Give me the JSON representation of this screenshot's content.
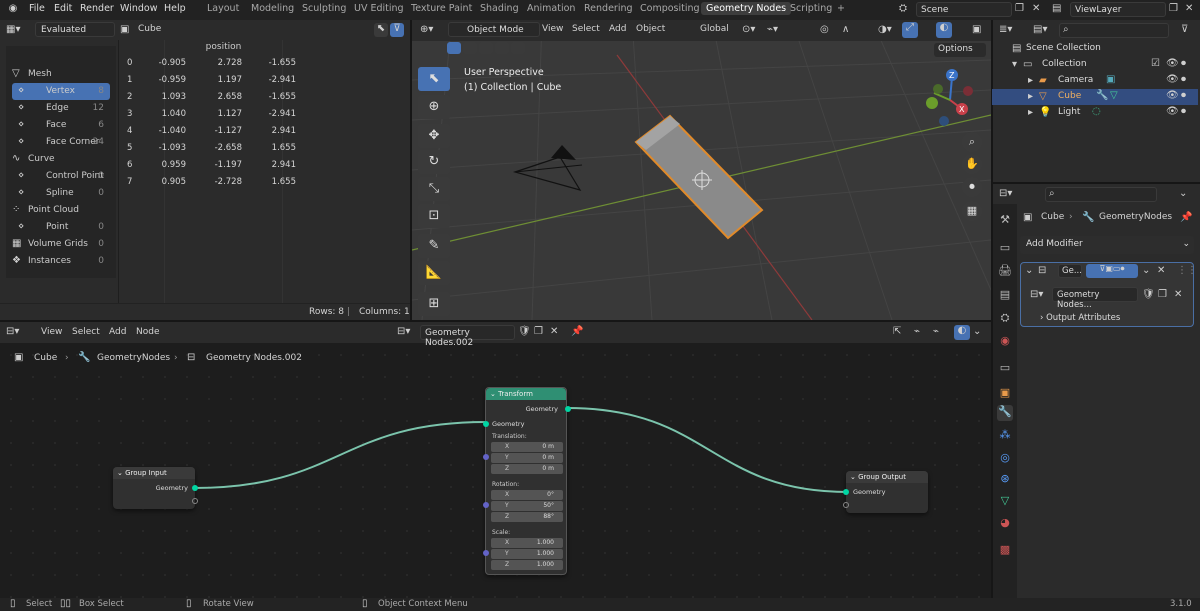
{
  "topbar": {
    "menus": [
      "File",
      "Edit",
      "Render",
      "Window",
      "Help"
    ],
    "workspaces": [
      "Layout",
      "Modeling",
      "Sculpting",
      "UV Editing",
      "Texture Paint",
      "Shading",
      "Animation",
      "Rendering",
      "Compositing",
      "Geometry Nodes",
      "Scripting",
      "+"
    ],
    "scene": "Scene",
    "viewlayer": "ViewLayer"
  },
  "spreadsheet": {
    "mode": "Evaluated",
    "object": "Cube",
    "col_header": "position",
    "tree": [
      {
        "label": "Mesh",
        "count": ""
      },
      {
        "label": "Vertex",
        "count": "8"
      },
      {
        "label": "Edge",
        "count": "12"
      },
      {
        "label": "Face",
        "count": "6"
      },
      {
        "label": "Face Corner",
        "count": "24"
      },
      {
        "label": "Curve",
        "count": ""
      },
      {
        "label": "Control Point",
        "count": "0"
      },
      {
        "label": "Spline",
        "count": "0"
      },
      {
        "label": "Point Cloud",
        "count": ""
      },
      {
        "label": "Point",
        "count": "0"
      },
      {
        "label": "Volume Grids",
        "count": "0"
      },
      {
        "label": "Instances",
        "count": "0"
      }
    ],
    "rows": [
      [
        "0",
        "-0.905",
        "2.728",
        "-1.655"
      ],
      [
        "1",
        "-0.959",
        "1.197",
        "-2.941"
      ],
      [
        "2",
        "1.093",
        "2.658",
        "-1.655"
      ],
      [
        "3",
        "1.040",
        "1.127",
        "-2.941"
      ],
      [
        "4",
        "-1.040",
        "-1.127",
        "2.941"
      ],
      [
        "5",
        "-1.093",
        "-2.658",
        "1.655"
      ],
      [
        "6",
        "0.959",
        "-1.197",
        "2.941"
      ],
      [
        "7",
        "0.905",
        "-2.728",
        "1.655"
      ]
    ],
    "footer_rows": "Rows: 8",
    "footer_cols": "Columns: 1"
  },
  "viewport": {
    "mode": "Object Mode",
    "menus": [
      "View",
      "Select",
      "Add",
      "Object"
    ],
    "orientation": "Global",
    "options": "Options",
    "title": "User Perspective",
    "subtitle": "(1) Collection | Cube"
  },
  "outliner": {
    "header": "Scene Collection",
    "collection": "Collection",
    "items": [
      "Camera",
      "Cube",
      "Light"
    ]
  },
  "properties": {
    "breadcrumb_obj": "Cube",
    "breadcrumb_mod": "GeometryNodes",
    "add_modifier": "Add Modifier",
    "mod_name": "Ge...",
    "node_group": "Geometry Nodes...",
    "output_attrs": "Output Attributes"
  },
  "node_editor": {
    "menus": [
      "View",
      "Select",
      "Add",
      "Node"
    ],
    "tree_name": "Geometry Nodes.002",
    "breadcrumb": [
      "Cube",
      "GeometryNodes",
      "Geometry Nodes.002"
    ],
    "group_input": {
      "title": "Group Input",
      "socket": "Geometry"
    },
    "group_output": {
      "title": "Group Output",
      "socket": "Geometry"
    },
    "transform": {
      "title": "Transform",
      "out": "Geometry",
      "in": "Geometry",
      "translation": "Translation:",
      "rotation": "Rotation:",
      "scale": "Scale:",
      "fields": [
        {
          "axis": "X",
          "t": "0 m",
          "r": "0°",
          "s": "1.000"
        },
        {
          "axis": "Y",
          "t": "0 m",
          "r": "50°",
          "s": "1.000"
        },
        {
          "axis": "Z",
          "t": "0 m",
          "r": "88°",
          "s": "1.000"
        }
      ]
    }
  },
  "statusbar": {
    "select": "Select",
    "box_select": "Box Select",
    "rotate": "Rotate View",
    "context": "Object Context Menu",
    "version": "3.1.0"
  }
}
